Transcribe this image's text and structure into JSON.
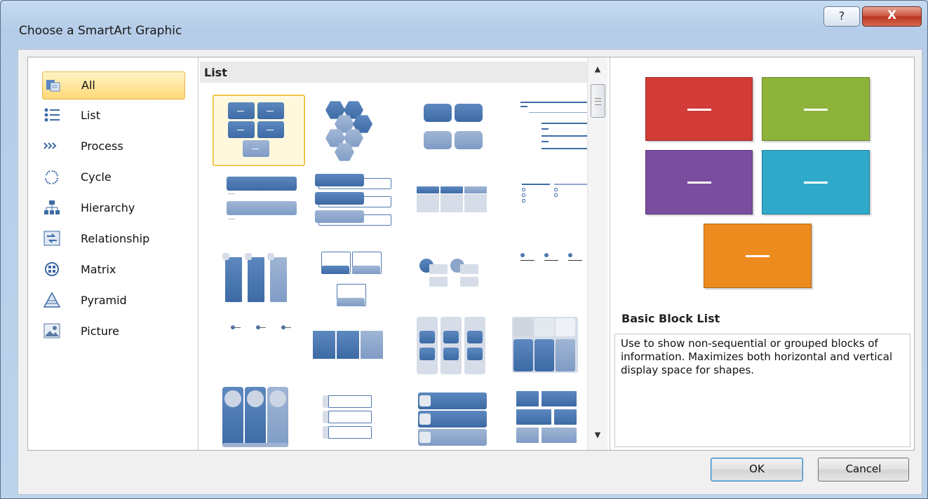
{
  "window": {
    "title": "Choose a SmartArt Graphic",
    "help_label": "?",
    "close_label": "X"
  },
  "categories": [
    {
      "label": "All",
      "icon": "all-icon",
      "selected": true
    },
    {
      "label": "List",
      "icon": "list-icon"
    },
    {
      "label": "Process",
      "icon": "process-icon"
    },
    {
      "label": "Cycle",
      "icon": "cycle-icon"
    },
    {
      "label": "Hierarchy",
      "icon": "hierarchy-icon"
    },
    {
      "label": "Relationship",
      "icon": "relationship-icon"
    },
    {
      "label": "Matrix",
      "icon": "matrix-icon"
    },
    {
      "label": "Pyramid",
      "icon": "pyramid-icon"
    },
    {
      "label": "Picture",
      "icon": "picture-icon"
    }
  ],
  "gallery": {
    "section_header": "List",
    "selected_index": 0
  },
  "preview": {
    "title": "Basic Block List",
    "description": "Use to show non-sequential or grouped blocks of information. Maximizes both horizontal and vertical display space for shapes.",
    "block_colors": [
      "#d13b38",
      "#8db33a",
      "#7a4d9e",
      "#2fa9c9",
      "#ee8b1f"
    ]
  },
  "buttons": {
    "ok": "OK",
    "cancel": "Cancel"
  }
}
